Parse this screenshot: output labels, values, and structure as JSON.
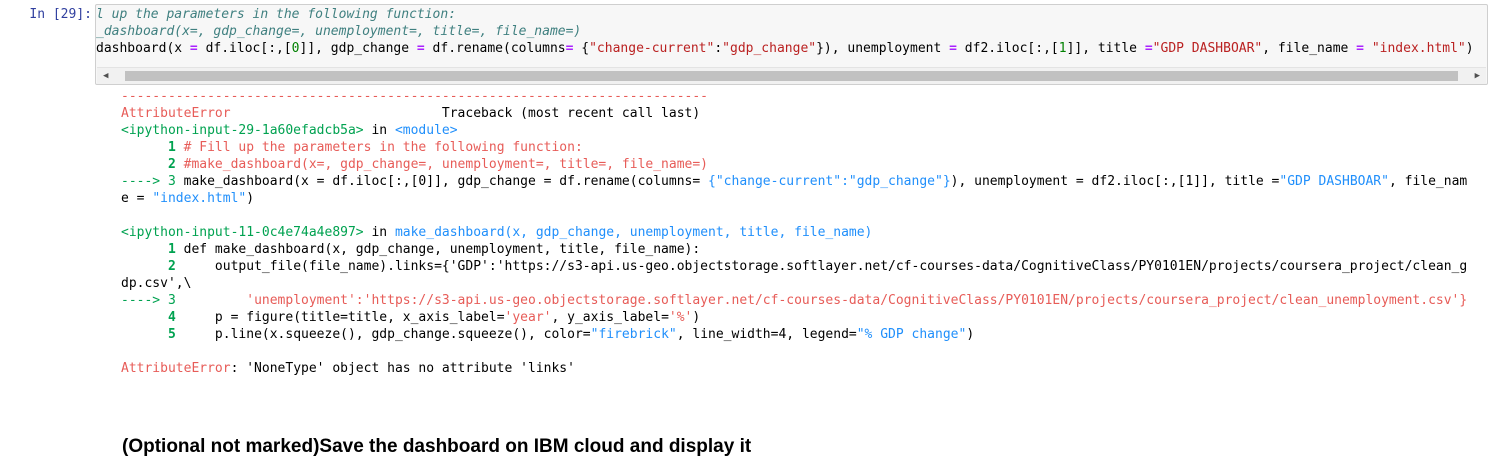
{
  "cell": {
    "prompt": "In [29]:",
    "code_lines": [
      "l up the parameters in the following function:",
      "_dashboard(x=, gdp_change=, unemployment=, title=, file_name=)"
    ],
    "code_main": {
      "fn": "dashboard(x ",
      "eq1": "=",
      "a1": " df.iloc[:,[",
      "n0": "0",
      "a2": "]], gdp_change ",
      "eq2": "=",
      "a3": " df.rename(columns",
      "eq3": "=",
      "a4": " {",
      "s1": "\"change-current\"",
      "a5": ":",
      "s2": "\"gdp_change\"",
      "a6": "}), unemployment ",
      "eq4": "=",
      "a7": " df2.iloc[:,[",
      "n1": "1",
      "a8": "]], title ",
      "eq5": "=",
      "s3": "\"GDP DASHBOAR\"",
      "a9": ", file_name ",
      "eq6": "=",
      "a10": " ",
      "s4": "\"index.html\"",
      "a11": ")"
    }
  },
  "traceback": {
    "dashes": "---------------------------------------------------------------------------",
    "error_name": "AttributeError",
    "tb_label": "                           Traceback (most recent call last)",
    "input1": "<ipython-input-29-1a60efadcb5a>",
    "in_word": " in ",
    "module": "<module>",
    "l1_num": "      1",
    "l1_text": " # Fill up the parameters in the following function:",
    "l2_num": "      2",
    "l2_text": " #make_dashboard(x=, gdp_change=, unemployment=, title=, file_name=)",
    "arrow3": "----> 3",
    "l3_a": " make_dashboard(x = df.iloc[:,[0]], gdp_change = df.rename(columns= ",
    "l3_b": "{\"change-current\":\"gdp_change\"}",
    "l3_c": "), unemployment = df2.iloc[:,[1]], title =",
    "l3_d": "\"GDP DASHBOAR\"",
    "l3_e": ", file_nam",
    "l3_wrap_a": "e = ",
    "l3_wrap_b": "\"index.html\"",
    "l3_wrap_c": ")",
    "input2": "<ipython-input-11-0c4e74a4e897>",
    "in_word2": " in ",
    "frame2": "make_dashboard(x, gdp_change, unemployment, title, file_name)",
    "f1_num": "      1",
    "f1_text": " def make_dashboard(x, gdp_change, unemployment, title, file_name):",
    "f2_num": "      2",
    "f2_text": "     output_file(file_name).links={'GDP':'https://s3-api.us-geo.objectstorage.softlayer.net/cf-courses-data/CognitiveClass/PY0101EN/projects/coursera_project/clean_g",
    "f2_wrap": "dp.csv',\\",
    "f3_arrow": "----> 3",
    "f3_text": "         'unemployment':'https://s3-api.us-geo.objectstorage.softlayer.net/cf-courses-data/CognitiveClass/PY0101EN/projects/coursera_project/clean_unemployment.csv'}",
    "f4_num": "      4",
    "f4_a": "     p = figure(title=title, x_axis_label=",
    "f4_b": "'year'",
    "f4_c": ", y_axis_label=",
    "f4_d": "'%'",
    "f4_e": ")",
    "f5_num": "      5",
    "f5_a": "     p.line(x.squeeze(), gdp_change.squeeze(), color=",
    "f5_b": "\"firebrick\"",
    "f5_c": ", line_width=4, legend=",
    "f5_d": "\"% GDP change\"",
    "f5_e": ")",
    "final_err": "AttributeError",
    "final_msg": ": 'NoneType' object has no attribute 'links'"
  },
  "markdown": {
    "heading": "(Optional not marked)Save the dashboard on IBM cloud and display it"
  },
  "icons": {
    "left_arrow": "scroll-left-icon",
    "right_arrow": "scroll-right-icon"
  }
}
